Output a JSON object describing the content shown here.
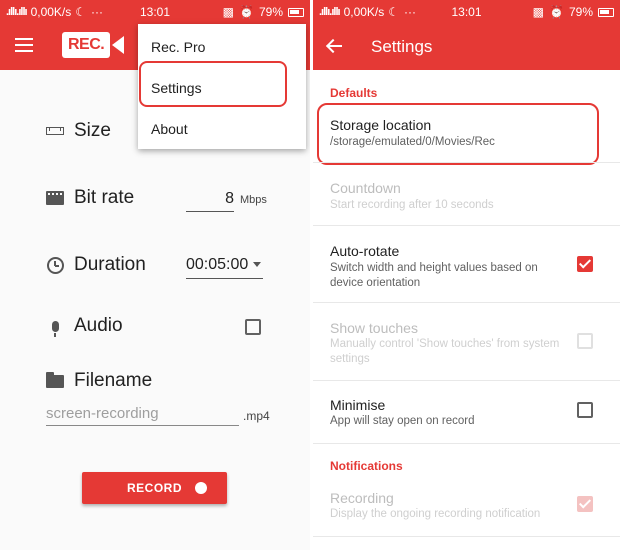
{
  "status_bar": {
    "signal": ".ıllı.ıllı",
    "speed": "0,00K/s",
    "dots": "···",
    "time": "13:01",
    "battery": "79%"
  },
  "left": {
    "logo_text": "REC.",
    "rows": {
      "size": "Size",
      "bitrate": "Bit rate",
      "duration": "Duration",
      "audio": "Audio",
      "filename": "Filename"
    },
    "bitrate_value": "8",
    "bitrate_unit": "Mbps",
    "duration_value": "00:05:00",
    "filename_placeholder": "screen-recording",
    "filename_ext": ".mp4",
    "audio_checked": false,
    "record_label": "RECORD",
    "menu": {
      "items": [
        "Rec. Pro",
        "Settings",
        "About"
      ]
    }
  },
  "right": {
    "title": "Settings",
    "sections": {
      "defaults": "Defaults",
      "notifications": "Notifications"
    },
    "prefs": {
      "storage": {
        "title": "Storage location",
        "summary": "/storage/emulated/0/Movies/Rec"
      },
      "countdown": {
        "title": "Countdown",
        "summary": "Start recording after 10 seconds"
      },
      "autorotate": {
        "title": "Auto-rotate",
        "summary": "Switch width and height values based on device orientation",
        "checked": true
      },
      "touches": {
        "title": "Show touches",
        "summary": "Manually control 'Show touches' from system settings",
        "checked": false
      },
      "minimise": {
        "title": "Minimise",
        "summary": "App will stay open on record",
        "checked": false
      },
      "recording": {
        "title": "Recording",
        "summary": "Display the ongoing recording notification",
        "checked": true
      }
    }
  },
  "colors": {
    "accent": "#e53935",
    "text": "#212121",
    "disabled": "#bdbdbd"
  }
}
